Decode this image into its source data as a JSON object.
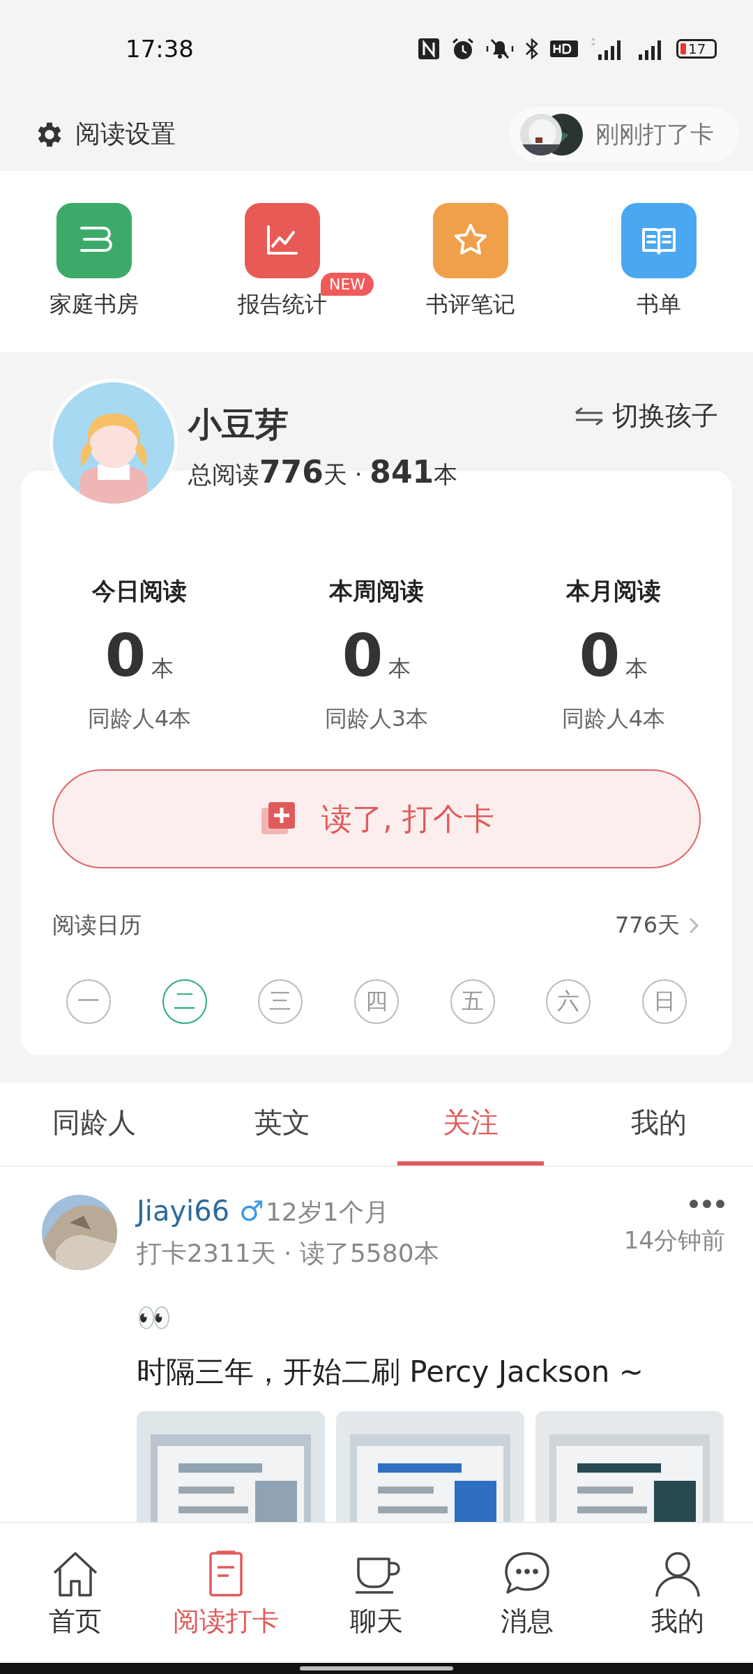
{
  "status_bar": {
    "time": "17:38",
    "battery": "17"
  },
  "header": {
    "settings_label": "阅读设置",
    "recent_checkin": "刚刚打了卡"
  },
  "shortcuts": [
    {
      "kind": "study",
      "label": "家庭书房"
    },
    {
      "kind": "chart",
      "label": "报告统计",
      "badge": "NEW"
    },
    {
      "kind": "star",
      "label": "书评笔记"
    },
    {
      "kind": "book",
      "label": "书单"
    }
  ],
  "profile": {
    "name": "小豆芽",
    "switch_label": "切换孩子",
    "total_prefix": "总阅读",
    "days": "776",
    "days_unit": "天 · ",
    "books": "841",
    "books_unit": "本"
  },
  "stats": [
    {
      "label": "今日阅读",
      "value": "0",
      "unit": "本",
      "peers": "同龄人4本"
    },
    {
      "label": "本周阅读",
      "value": "0",
      "unit": "本",
      "peers": "同龄人3本"
    },
    {
      "label": "本月阅读",
      "value": "0",
      "unit": "本",
      "peers": "同龄人4本"
    }
  ],
  "checkin_button": "读了, 打个卡",
  "calendar": {
    "title": "阅读日历",
    "count": "776天",
    "days": [
      {
        "label": "一",
        "selected": false
      },
      {
        "label": "二",
        "selected": true
      },
      {
        "label": "三",
        "selected": false
      },
      {
        "label": "四",
        "selected": false
      },
      {
        "label": "五",
        "selected": false
      },
      {
        "label": "六",
        "selected": false
      },
      {
        "label": "日",
        "selected": false
      }
    ]
  },
  "feed_tabs": [
    {
      "label": "同龄人",
      "selected": false
    },
    {
      "label": "英文",
      "selected": false
    },
    {
      "label": "关注",
      "selected": true
    },
    {
      "label": "我的",
      "selected": false
    }
  ],
  "post": {
    "user": "Jiayi66",
    "gender": "♂",
    "age": "12岁1个月",
    "stats": "打卡2311天 · 读了5580本",
    "time": "14分钟前",
    "emoji": "👀",
    "text": "时隔三年，开始二刷 Percy Jackson ~"
  },
  "bottom_nav": [
    {
      "kind": "home",
      "label": "首页",
      "selected": false
    },
    {
      "kind": "checkin",
      "label": "阅读打卡",
      "selected": true
    },
    {
      "kind": "cup",
      "label": "聊天",
      "selected": false
    },
    {
      "kind": "chat",
      "label": "消息",
      "selected": false
    },
    {
      "kind": "person",
      "label": "我的",
      "selected": false
    }
  ]
}
